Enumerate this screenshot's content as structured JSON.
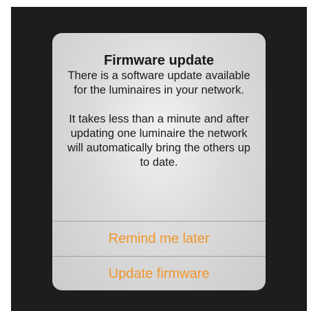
{
  "alert": {
    "title": "Firmware update",
    "message": "There is a software update available for the luminaires in your network.\n\nIt takes less than a minute and after updating one luminaire the network will automatically bring the others up to date.",
    "buttons": [
      {
        "label": "Remind me later"
      },
      {
        "label": "Update firmware"
      }
    ]
  },
  "colors": {
    "accent": "#f0962d",
    "backdrop": "#1d1d1d",
    "dialog_bg": "#dcdcdc"
  }
}
